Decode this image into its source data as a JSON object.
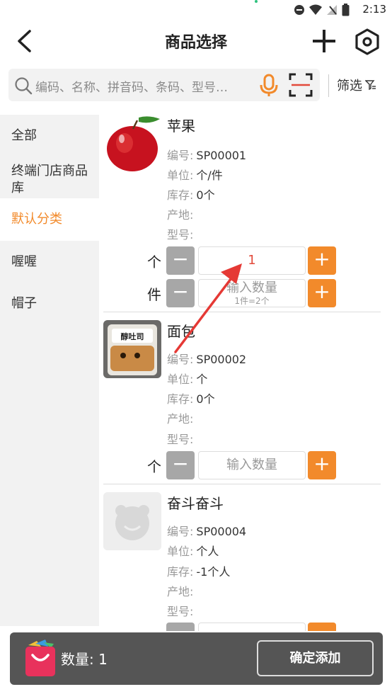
{
  "status_bar": {
    "time": "2:13"
  },
  "header": {
    "title": "商品选择"
  },
  "search": {
    "placeholder": "编码、名称、拼音码、条码、型号…",
    "filter_label": "筛选"
  },
  "sidebar": {
    "items": [
      {
        "label": "全部"
      },
      {
        "label": "终端门店商品库"
      },
      {
        "label": "默认分类"
      },
      {
        "label": "喔喔"
      },
      {
        "label": "帽子"
      }
    ]
  },
  "field_labels": {
    "code": "编号:",
    "unit": "单位:",
    "stock": "库存:",
    "origin": "产地:",
    "model": "型号:"
  },
  "products": [
    {
      "name": "苹果",
      "code": "SP00001",
      "unit": "个/件",
      "stock": "0个",
      "origin": "",
      "model": "",
      "rows": [
        {
          "unit": "个",
          "value": "1",
          "placeholder": ""
        },
        {
          "unit": "件",
          "value": "",
          "placeholder": "输入数量",
          "hint": "1件=2个"
        }
      ]
    },
    {
      "name": "面包",
      "code": "SP00002",
      "unit": "个",
      "stock": "0个",
      "origin": "",
      "model": "",
      "image_text": "醇吐司",
      "rows": [
        {
          "unit": "个",
          "value": "",
          "placeholder": "输入数量"
        }
      ]
    },
    {
      "name": "奋斗奋斗",
      "code": "SP00004",
      "unit": "个人",
      "stock": "-1个人",
      "origin": "",
      "model": ""
    }
  ],
  "qty_buttons": {
    "minus": "−",
    "plus": "+"
  },
  "footer": {
    "quantity": "数量: 1",
    "confirm_label": "确定添加"
  },
  "colors": {
    "accent": "#f28a2b",
    "minus_bg": "#a7a7a7",
    "value_red": "#e24a3b",
    "footer_bg": "#555555",
    "annotation_arrow": "#e53935"
  }
}
